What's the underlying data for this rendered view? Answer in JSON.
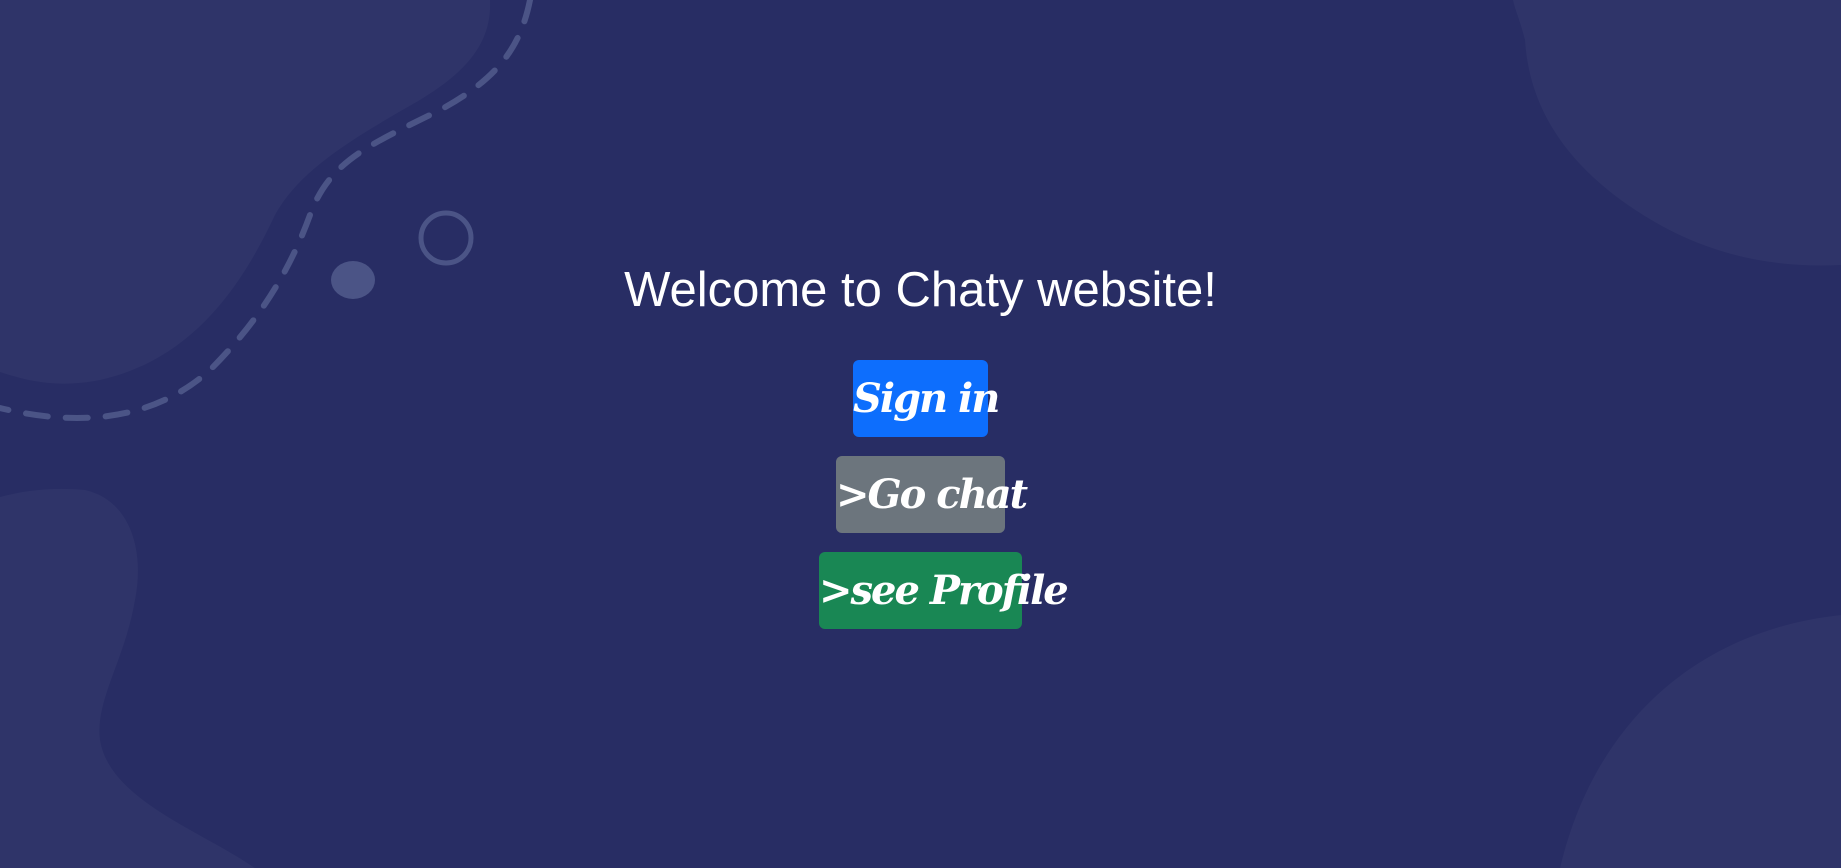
{
  "page": {
    "title": "Welcome to Chaty website!"
  },
  "actions": {
    "sign_in_label": "Sign in",
    "go_chat_label": ">Go chat",
    "see_profile_label": ">see Profile"
  },
  "colors": {
    "background": "#282d64",
    "blob": "#2f3469",
    "decoration": "#4b5486",
    "sign_in": "#0d6efd",
    "go_chat": "#6c757d",
    "see_profile": "#198754",
    "text": "#ffffff"
  }
}
